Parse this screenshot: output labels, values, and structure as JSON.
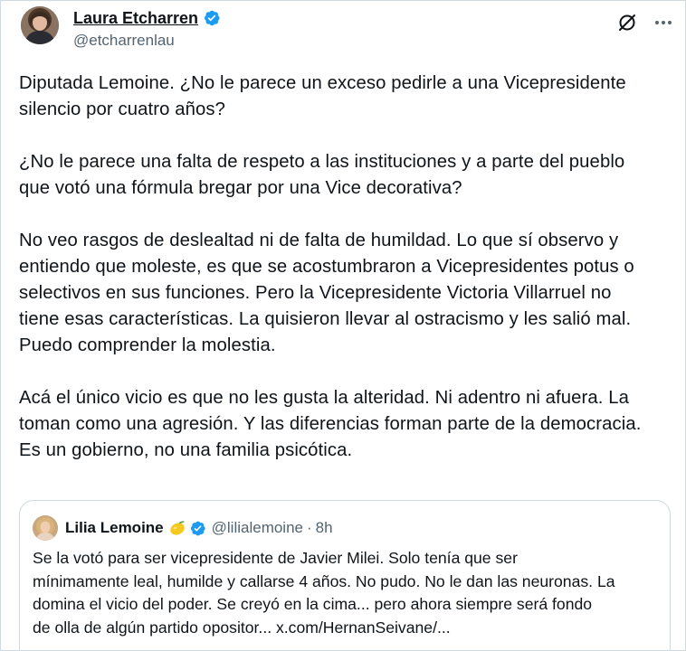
{
  "tweet": {
    "author": {
      "name": "Laura Etcharren",
      "handle": "@etcharrenlau",
      "verified": true,
      "avatar_icon": "author-avatar-photo"
    },
    "actions": {
      "grok_icon": "grok-slash-icon",
      "more_icon": "more-options-icon"
    },
    "paragraphs": [
      "Diputada Lemoine. ¿No le parece un exceso pedirle a una Vicepresidente\nsilencio por cuatro años?",
      "¿No le parece una falta de respeto a las instituciones y a parte del pueblo\nque votó una fórmula bregar por una Vice decorativa?",
      "No veo rasgos de deslealtad ni de falta de humildad. Lo que sí observo y\nentiendo que moleste, es que se acostumbraron a Vicepresidentes potus o\nselectivos en sus funciones. Pero la Vicepresidente Victoria Villarruel no\ntiene esas características. La quisieron llevar al ostracismo y les salió mal.\nPuedo comprender la molestia.",
      "Acá el único vicio es que no les gusta la alteridad. Ni adentro ni afuera. La\ntoman como una agresión. Y las diferencias forman parte de la democracia.\nEs un gobierno, no una familia psicótica."
    ]
  },
  "quoted_tweet": {
    "author": {
      "name": "Lilia Lemoine",
      "emoji": "🍋",
      "handle": "@lilialemoine",
      "separator": "·",
      "time": "8h",
      "verified": true
    },
    "text": "Se la votó para ser vicepresidente de Javier Milei. Solo tenía que ser\nmínimamente leal, humilde y callarse 4 años. No pudo. No le dan las neuronas. La\ndomina el vicio del poder. Se creyó en la cima... pero   ahora siempre será fondo\nde  olla de algún partido opositor... x.com/HernanSeivane/..."
  },
  "colors": {
    "text": "#0f1419",
    "secondary": "#536471",
    "verified_blue": "#1d9bf0",
    "border": "#cfd9de"
  }
}
